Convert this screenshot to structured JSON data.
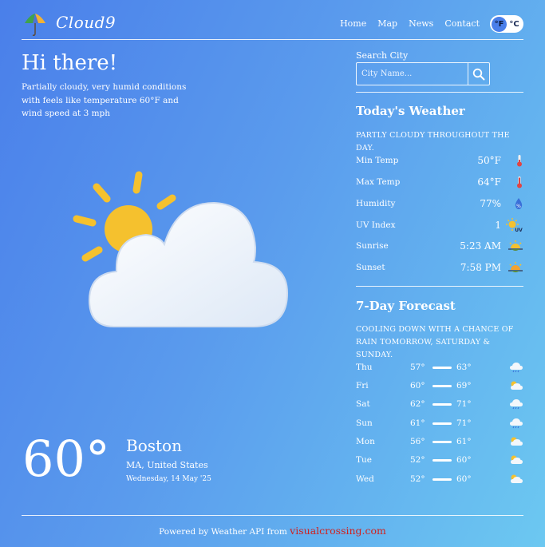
{
  "app": {
    "name": "Cloud9"
  },
  "nav": {
    "items": [
      "Home",
      "Map",
      "News",
      "Contact"
    ]
  },
  "units": {
    "fahrenheit": "°F",
    "celsius": "°C",
    "selected": "°F"
  },
  "greeting": "Hi there!",
  "summary": "Partially cloudy, very humid conditions with feels like temperature 60°F and wind speed at 3 mph",
  "current": {
    "temp": "60°",
    "city": "Boston",
    "region": "MA, United States",
    "date": "Wednesday, 14 May '25",
    "icon": "partly-cloudy-day-icon"
  },
  "search": {
    "label": "Search City",
    "placeholder": "City Name..."
  },
  "today": {
    "title": "Today's Weather",
    "description": "PARTLY CLOUDY THROUGHOUT THE DAY.",
    "rows": [
      {
        "label": "Min Temp",
        "value": "50°F",
        "icon": "thermometer-low-icon"
      },
      {
        "label": "Max Temp",
        "value": "64°F",
        "icon": "thermometer-high-icon"
      },
      {
        "label": "Humidity",
        "value": "77%",
        "icon": "humidity-drop-icon"
      },
      {
        "label": "UV Index",
        "value": "1",
        "icon": "uv-sun-icon"
      },
      {
        "label": "Sunrise",
        "value": "5:23 AM",
        "icon": "sunrise-icon"
      },
      {
        "label": "Sunset",
        "value": "7:58 PM",
        "icon": "sunset-icon"
      }
    ]
  },
  "forecast": {
    "title": "7-Day Forecast",
    "description": "COOLING DOWN WITH A CHANCE OF RAIN TOMORROW, SATURDAY & SUNDAY.",
    "days": [
      {
        "day": "Thu",
        "low": "57°",
        "high": "63°",
        "icon": "rain-cloud-icon"
      },
      {
        "day": "Fri",
        "low": "60°",
        "high": "69°",
        "icon": "partly-cloudy-icon"
      },
      {
        "day": "Sat",
        "low": "62°",
        "high": "71°",
        "icon": "rain-cloud-icon"
      },
      {
        "day": "Sun",
        "low": "61°",
        "high": "71°",
        "icon": "rain-cloud-icon"
      },
      {
        "day": "Mon",
        "low": "56°",
        "high": "61°",
        "icon": "partly-cloudy-icon"
      },
      {
        "day": "Tue",
        "low": "52°",
        "high": "60°",
        "icon": "partly-cloudy-icon"
      },
      {
        "day": "Wed",
        "low": "52°",
        "high": "60°",
        "icon": "partly-cloudy-icon"
      }
    ]
  },
  "footer": {
    "text": "Powered by Weather API from ",
    "link": "visualcrossing.com"
  },
  "colors": {
    "bg_start": "#4a7fea",
    "bg_end": "#6cc8f1",
    "link": "#d0221f",
    "sun": "#f5c12e"
  }
}
